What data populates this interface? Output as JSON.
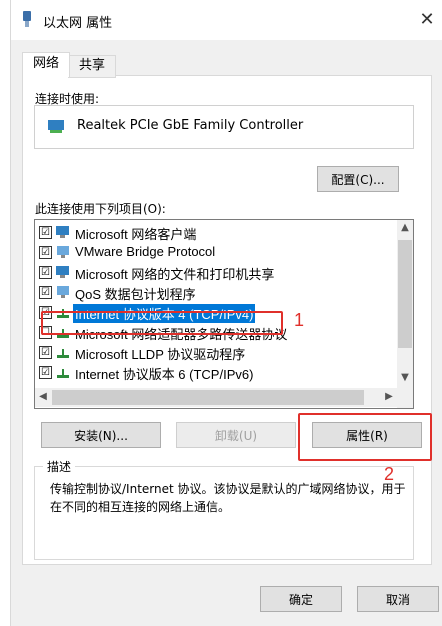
{
  "window": {
    "title": "以太网 属性",
    "close_label": "✕"
  },
  "tabs": [
    {
      "label": "网络"
    },
    {
      "label": "共享"
    }
  ],
  "connect_using": {
    "label": "连接时使用:",
    "adapter_name": "Realtek PCIe GbE Family Controller"
  },
  "buttons": {
    "configure": "配置(C)...",
    "install": "安装(N)...",
    "uninstall": "卸载(U)",
    "properties": "属性(R)",
    "ok": "确定",
    "cancel": "取消"
  },
  "items_label": "此连接使用下列项目(O):",
  "items": [
    {
      "label": "Microsoft 网络客户端",
      "checked": "☑",
      "icon": "network-client-icon"
    },
    {
      "label": "VMware Bridge Protocol",
      "checked": "☑",
      "icon": "network-service-icon"
    },
    {
      "label": "Microsoft 网络的文件和打印机共享",
      "checked": "☑",
      "icon": "network-client-icon"
    },
    {
      "label": "QoS 数据包计划程序",
      "checked": "☑",
      "icon": "network-service-icon"
    },
    {
      "label": "Internet 协议版本 4 (TCP/IPv4)",
      "checked": "☑",
      "icon": "protocol-icon"
    },
    {
      "label": "Microsoft 网络适配器多路传送器协议",
      "checked": "☐",
      "icon": "protocol-icon"
    },
    {
      "label": "Microsoft LLDP 协议驱动程序",
      "checked": "☑",
      "icon": "protocol-icon"
    },
    {
      "label": "Internet 协议版本 6 (TCP/IPv6)",
      "checked": "☑",
      "icon": "protocol-icon"
    }
  ],
  "description": {
    "title": "描述",
    "text": "传输控制协议/Internet 协议。该协议是默认的广域网络协议，用于在不同的相互连接的网络上通信。"
  },
  "annotations": {
    "one": "1",
    "two": "2"
  },
  "colors": {
    "selection": "#0078d7",
    "annotation": "#e0302b"
  }
}
